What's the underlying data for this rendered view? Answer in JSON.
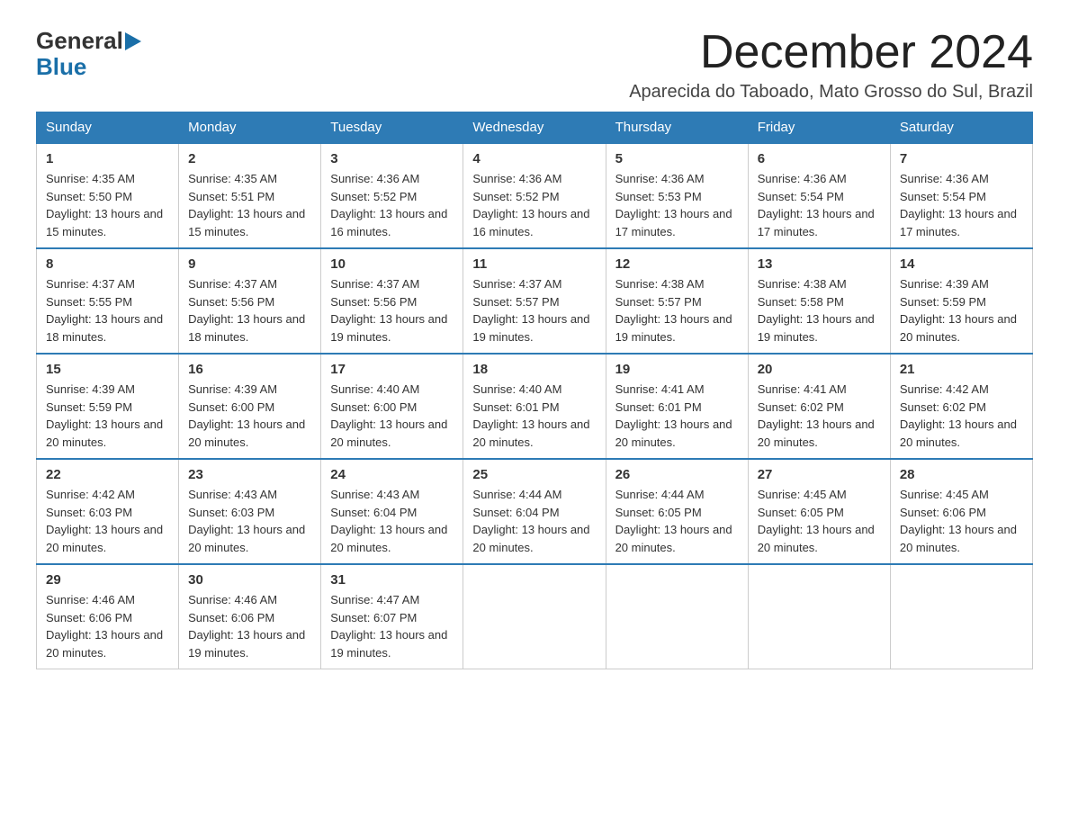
{
  "logo": {
    "general": "General",
    "blue": "Blue",
    "arrow": "▶"
  },
  "header": {
    "month_year": "December 2024",
    "location": "Aparecida do Taboado, Mato Grosso do Sul, Brazil"
  },
  "weekdays": [
    "Sunday",
    "Monday",
    "Tuesday",
    "Wednesday",
    "Thursday",
    "Friday",
    "Saturday"
  ],
  "weeks": [
    [
      {
        "day": "1",
        "sunrise": "Sunrise: 4:35 AM",
        "sunset": "Sunset: 5:50 PM",
        "daylight": "Daylight: 13 hours and 15 minutes."
      },
      {
        "day": "2",
        "sunrise": "Sunrise: 4:35 AM",
        "sunset": "Sunset: 5:51 PM",
        "daylight": "Daylight: 13 hours and 15 minutes."
      },
      {
        "day": "3",
        "sunrise": "Sunrise: 4:36 AM",
        "sunset": "Sunset: 5:52 PM",
        "daylight": "Daylight: 13 hours and 16 minutes."
      },
      {
        "day": "4",
        "sunrise": "Sunrise: 4:36 AM",
        "sunset": "Sunset: 5:52 PM",
        "daylight": "Daylight: 13 hours and 16 minutes."
      },
      {
        "day": "5",
        "sunrise": "Sunrise: 4:36 AM",
        "sunset": "Sunset: 5:53 PM",
        "daylight": "Daylight: 13 hours and 17 minutes."
      },
      {
        "day": "6",
        "sunrise": "Sunrise: 4:36 AM",
        "sunset": "Sunset: 5:54 PM",
        "daylight": "Daylight: 13 hours and 17 minutes."
      },
      {
        "day": "7",
        "sunrise": "Sunrise: 4:36 AM",
        "sunset": "Sunset: 5:54 PM",
        "daylight": "Daylight: 13 hours and 17 minutes."
      }
    ],
    [
      {
        "day": "8",
        "sunrise": "Sunrise: 4:37 AM",
        "sunset": "Sunset: 5:55 PM",
        "daylight": "Daylight: 13 hours and 18 minutes."
      },
      {
        "day": "9",
        "sunrise": "Sunrise: 4:37 AM",
        "sunset": "Sunset: 5:56 PM",
        "daylight": "Daylight: 13 hours and 18 minutes."
      },
      {
        "day": "10",
        "sunrise": "Sunrise: 4:37 AM",
        "sunset": "Sunset: 5:56 PM",
        "daylight": "Daylight: 13 hours and 19 minutes."
      },
      {
        "day": "11",
        "sunrise": "Sunrise: 4:37 AM",
        "sunset": "Sunset: 5:57 PM",
        "daylight": "Daylight: 13 hours and 19 minutes."
      },
      {
        "day": "12",
        "sunrise": "Sunrise: 4:38 AM",
        "sunset": "Sunset: 5:57 PM",
        "daylight": "Daylight: 13 hours and 19 minutes."
      },
      {
        "day": "13",
        "sunrise": "Sunrise: 4:38 AM",
        "sunset": "Sunset: 5:58 PM",
        "daylight": "Daylight: 13 hours and 19 minutes."
      },
      {
        "day": "14",
        "sunrise": "Sunrise: 4:39 AM",
        "sunset": "Sunset: 5:59 PM",
        "daylight": "Daylight: 13 hours and 20 minutes."
      }
    ],
    [
      {
        "day": "15",
        "sunrise": "Sunrise: 4:39 AM",
        "sunset": "Sunset: 5:59 PM",
        "daylight": "Daylight: 13 hours and 20 minutes."
      },
      {
        "day": "16",
        "sunrise": "Sunrise: 4:39 AM",
        "sunset": "Sunset: 6:00 PM",
        "daylight": "Daylight: 13 hours and 20 minutes."
      },
      {
        "day": "17",
        "sunrise": "Sunrise: 4:40 AM",
        "sunset": "Sunset: 6:00 PM",
        "daylight": "Daylight: 13 hours and 20 minutes."
      },
      {
        "day": "18",
        "sunrise": "Sunrise: 4:40 AM",
        "sunset": "Sunset: 6:01 PM",
        "daylight": "Daylight: 13 hours and 20 minutes."
      },
      {
        "day": "19",
        "sunrise": "Sunrise: 4:41 AM",
        "sunset": "Sunset: 6:01 PM",
        "daylight": "Daylight: 13 hours and 20 minutes."
      },
      {
        "day": "20",
        "sunrise": "Sunrise: 4:41 AM",
        "sunset": "Sunset: 6:02 PM",
        "daylight": "Daylight: 13 hours and 20 minutes."
      },
      {
        "day": "21",
        "sunrise": "Sunrise: 4:42 AM",
        "sunset": "Sunset: 6:02 PM",
        "daylight": "Daylight: 13 hours and 20 minutes."
      }
    ],
    [
      {
        "day": "22",
        "sunrise": "Sunrise: 4:42 AM",
        "sunset": "Sunset: 6:03 PM",
        "daylight": "Daylight: 13 hours and 20 minutes."
      },
      {
        "day": "23",
        "sunrise": "Sunrise: 4:43 AM",
        "sunset": "Sunset: 6:03 PM",
        "daylight": "Daylight: 13 hours and 20 minutes."
      },
      {
        "day": "24",
        "sunrise": "Sunrise: 4:43 AM",
        "sunset": "Sunset: 6:04 PM",
        "daylight": "Daylight: 13 hours and 20 minutes."
      },
      {
        "day": "25",
        "sunrise": "Sunrise: 4:44 AM",
        "sunset": "Sunset: 6:04 PM",
        "daylight": "Daylight: 13 hours and 20 minutes."
      },
      {
        "day": "26",
        "sunrise": "Sunrise: 4:44 AM",
        "sunset": "Sunset: 6:05 PM",
        "daylight": "Daylight: 13 hours and 20 minutes."
      },
      {
        "day": "27",
        "sunrise": "Sunrise: 4:45 AM",
        "sunset": "Sunset: 6:05 PM",
        "daylight": "Daylight: 13 hours and 20 minutes."
      },
      {
        "day": "28",
        "sunrise": "Sunrise: 4:45 AM",
        "sunset": "Sunset: 6:06 PM",
        "daylight": "Daylight: 13 hours and 20 minutes."
      }
    ],
    [
      {
        "day": "29",
        "sunrise": "Sunrise: 4:46 AM",
        "sunset": "Sunset: 6:06 PM",
        "daylight": "Daylight: 13 hours and 20 minutes."
      },
      {
        "day": "30",
        "sunrise": "Sunrise: 4:46 AM",
        "sunset": "Sunset: 6:06 PM",
        "daylight": "Daylight: 13 hours and 19 minutes."
      },
      {
        "day": "31",
        "sunrise": "Sunrise: 4:47 AM",
        "sunset": "Sunset: 6:07 PM",
        "daylight": "Daylight: 13 hours and 19 minutes."
      },
      null,
      null,
      null,
      null
    ]
  ]
}
